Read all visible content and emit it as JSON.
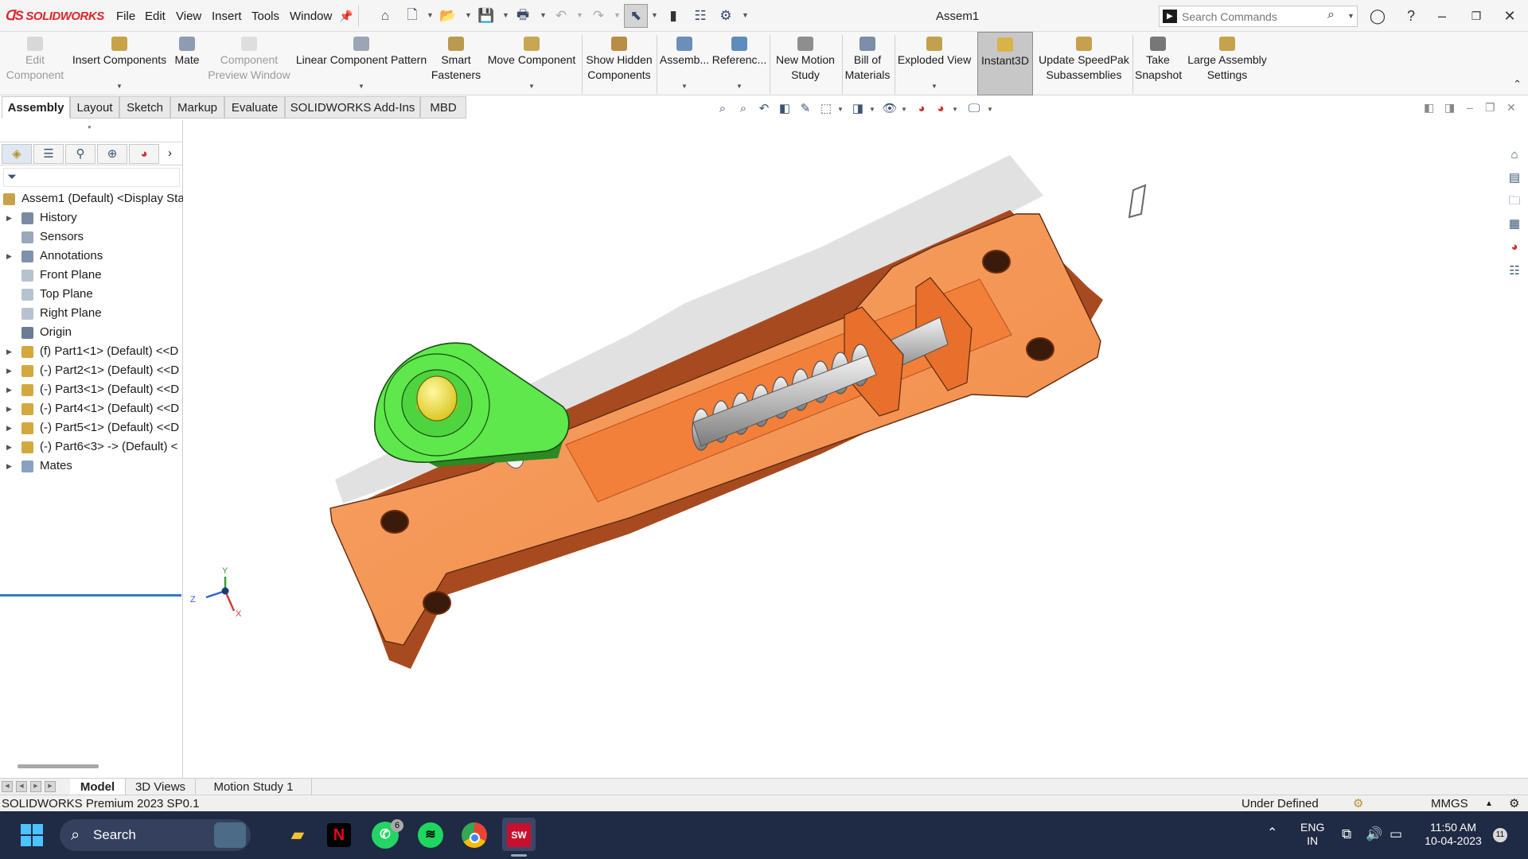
{
  "app": {
    "logo_text": "SOLIDWORKS",
    "title": "Assem1",
    "brand_color": "#d9262c"
  },
  "menu": [
    "File",
    "Edit",
    "View",
    "Insert",
    "Tools",
    "Window"
  ],
  "search": {
    "placeholder": "Search Commands"
  },
  "command_manager": {
    "buttons": [
      {
        "label": "Edit Component",
        "enabled": false
      },
      {
        "label": "Insert Components",
        "enabled": true
      },
      {
        "label": "Mate",
        "enabled": true
      },
      {
        "label": "Component Preview Window",
        "enabled": false
      },
      {
        "label": "Linear Component Pattern",
        "enabled": true
      },
      {
        "label": "Smart Fasteners",
        "enabled": true
      },
      {
        "label": "Move Component",
        "enabled": true
      },
      {
        "label": "Show Hidden Components",
        "enabled": true
      },
      {
        "label": "Assemb...",
        "enabled": true
      },
      {
        "label": "Referenc...",
        "enabled": true
      },
      {
        "label": "New Motion Study",
        "enabled": true
      },
      {
        "label": "Bill of Materials",
        "enabled": true
      },
      {
        "label": "Exploded View",
        "enabled": true
      },
      {
        "label": "Instant3D",
        "enabled": true,
        "active": true
      },
      {
        "label": "Update SpeedPak Subassemblies",
        "enabled": true
      },
      {
        "label": "Take Snapshot",
        "enabled": true
      },
      {
        "label": "Large Assembly Settings",
        "enabled": true
      }
    ]
  },
  "tabs": [
    {
      "label": "Assembly",
      "active": true
    },
    {
      "label": "Layout"
    },
    {
      "label": "Sketch"
    },
    {
      "label": "Markup"
    },
    {
      "label": "Evaluate"
    },
    {
      "label": "SOLIDWORKS Add-Ins"
    },
    {
      "label": "MBD"
    }
  ],
  "feature_tree": {
    "root": "Assem1 (Default) <Display Sta",
    "items": [
      {
        "label": "History",
        "expandable": true,
        "icon": "history-icon"
      },
      {
        "label": "Sensors",
        "expandable": false,
        "icon": "sensors-icon"
      },
      {
        "label": "Annotations",
        "expandable": true,
        "icon": "annotations-icon"
      },
      {
        "label": "Front Plane",
        "expandable": false,
        "icon": "plane-icon"
      },
      {
        "label": "Top Plane",
        "expandable": false,
        "icon": "plane-icon"
      },
      {
        "label": "Right Plane",
        "expandable": false,
        "icon": "plane-icon"
      },
      {
        "label": "Origin",
        "expandable": false,
        "icon": "origin-icon"
      },
      {
        "label": "(f) Part1<1> (Default) <<D",
        "expandable": true,
        "icon": "part-icon"
      },
      {
        "label": "(-) Part2<1> (Default) <<D",
        "expandable": true,
        "icon": "part-icon"
      },
      {
        "label": "(-) Part3<1> (Default) <<D",
        "expandable": true,
        "icon": "part-icon"
      },
      {
        "label": "(-) Part4<1> (Default) <<D",
        "expandable": true,
        "icon": "part-icon"
      },
      {
        "label": "(-) Part5<1> (Default) <<D",
        "expandable": true,
        "icon": "part-icon"
      },
      {
        "label": "(-) Part6<3> -> (Default) <",
        "expandable": true,
        "icon": "part-icon"
      },
      {
        "label": "Mates",
        "expandable": true,
        "icon": "mates-icon"
      }
    ]
  },
  "triad": {
    "x": "X",
    "y": "Y",
    "z": "Z"
  },
  "bottom_tabs": [
    {
      "label": "Model",
      "active": true
    },
    {
      "label": "3D Views"
    },
    {
      "label": "Motion Study 1"
    }
  ],
  "status": {
    "product": "SOLIDWORKS Premium 2023 SP0.1",
    "state": "Under Defined",
    "units": "MMGS"
  },
  "taskbar": {
    "search_label": "Search",
    "whatsapp_badge": "6",
    "lang_line1": "ENG",
    "lang_line2": "IN",
    "time": "11:50 AM",
    "date": "10-04-2023",
    "notification_count": "11"
  },
  "colors": {
    "base_plate": "#f5944f",
    "cam": "#5ee84c",
    "pin": "#f0e23a",
    "selection_blue": "#2f7bd1"
  }
}
